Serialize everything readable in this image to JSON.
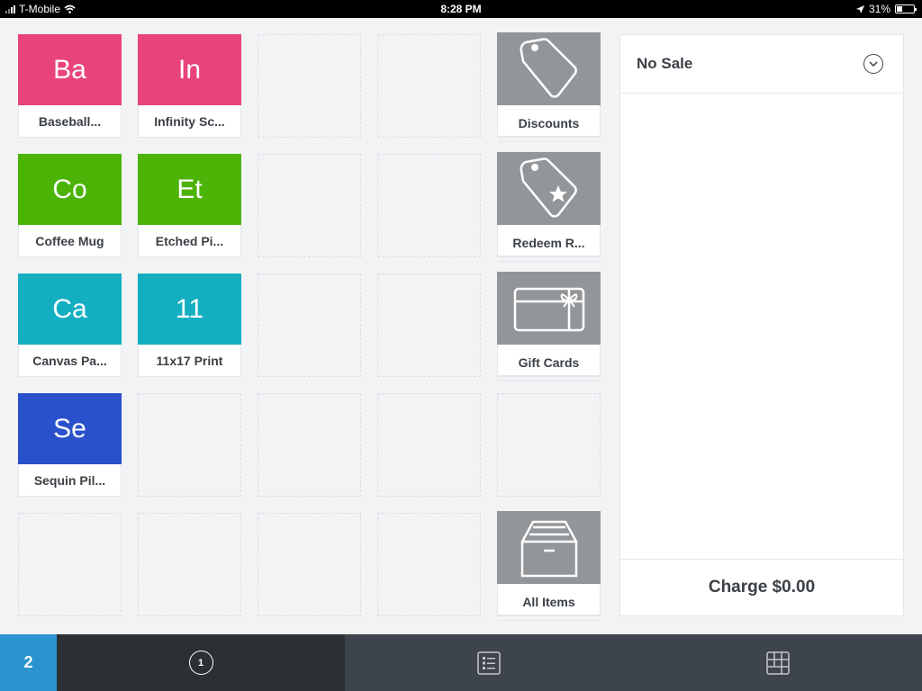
{
  "status_bar": {
    "carrier": "T-Mobile",
    "time": "8:28 PM",
    "battery_percent_label": "31%",
    "battery_level": 0.31
  },
  "grid": {
    "tiles": [
      {
        "row": 0,
        "col": 0,
        "type": "item",
        "abbr": "Ba",
        "label": "Baseball...",
        "color": "#e8437a"
      },
      {
        "row": 0,
        "col": 1,
        "type": "item",
        "abbr": "In",
        "label": "Infinity Sc...",
        "color": "#e8437a"
      },
      {
        "row": 0,
        "col": 4,
        "type": "special",
        "icon": "tag-icon",
        "label": "Discounts"
      },
      {
        "row": 1,
        "col": 0,
        "type": "item",
        "abbr": "Co",
        "label": "Coffee Mug",
        "color": "#4cb307"
      },
      {
        "row": 1,
        "col": 1,
        "type": "item",
        "abbr": "Et",
        "label": "Etched Pi...",
        "color": "#4cb307"
      },
      {
        "row": 1,
        "col": 4,
        "type": "special",
        "icon": "reward-tag-icon",
        "label": "Redeem R..."
      },
      {
        "row": 2,
        "col": 0,
        "type": "item",
        "abbr": "Ca",
        "label": "Canvas Pa...",
        "color": "#13afc1"
      },
      {
        "row": 2,
        "col": 1,
        "type": "item",
        "abbr": "11",
        "label": "11x17 Print",
        "color": "#13afc1"
      },
      {
        "row": 2,
        "col": 4,
        "type": "special",
        "icon": "gift-card-icon",
        "label": "Gift Cards"
      },
      {
        "row": 3,
        "col": 0,
        "type": "item",
        "abbr": "Se",
        "label": "Sequin Pil...",
        "color": "#2a51cc"
      },
      {
        "row": 4,
        "col": 4,
        "type": "special",
        "icon": "archive-box-icon",
        "label": "All Items"
      }
    ]
  },
  "cart": {
    "title": "No Sale",
    "charge_label": "Charge $0.00"
  },
  "bottom_bar": {
    "badge": "2",
    "tabs": [
      {
        "name": "keypad",
        "icon": "circle-number-icon",
        "label": "1",
        "active": true
      },
      {
        "name": "library",
        "icon": "list-icon",
        "active": false
      },
      {
        "name": "favorites",
        "icon": "grid-icon",
        "active": false
      }
    ]
  }
}
